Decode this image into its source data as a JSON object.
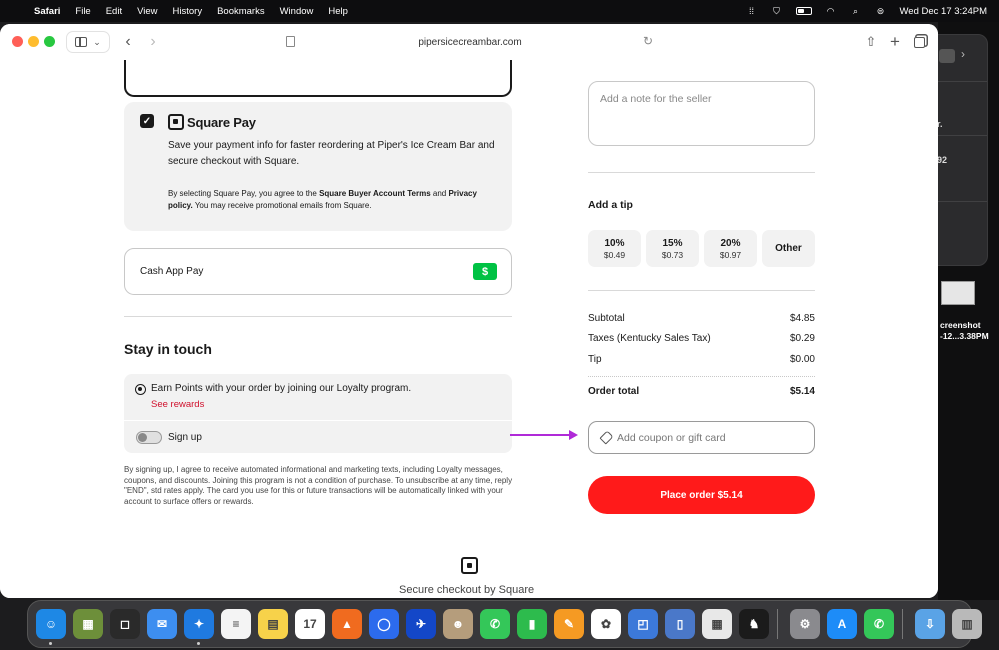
{
  "menubar": {
    "app_name": "Safari",
    "menus": [
      "File",
      "Edit",
      "View",
      "History",
      "Bookmarks",
      "Window",
      "Help"
    ],
    "datetime": "Wed Dec 17  3:24PM"
  },
  "browser": {
    "url": "pipersicecreambar.com"
  },
  "square_pay": {
    "name": "Square Pay",
    "description": "Save your payment info for faster reordering at Piper's Ice Cream Bar and secure checkout with Square.",
    "legal_prefix": "By selecting Square Pay, you agree to the ",
    "legal_terms_link": "Square Buyer Account Terms",
    "legal_and": " and ",
    "legal_privacy_link": "Privacy policy.",
    "legal_suffix": " You may receive promotional emails from Square.",
    "checked": true
  },
  "cash_app": {
    "label": "Cash App Pay",
    "icon_glyph": "$"
  },
  "stay_in_touch": {
    "heading": "Stay in touch",
    "loyalty_text": "Earn Points with your order by joining our Loyalty program.",
    "see_rewards": "See rewards",
    "signup_label": "Sign up",
    "legal": "By signing up, I agree to receive automated informational and marketing texts, including Loyalty messages, coupons, and discounts. Joining this program is not a condition of purchase. To unsubscribe at any time, reply \"END\", std rates apply. The card you use for this or future transactions will be automatically linked with your account to surface offers or rewards."
  },
  "seller_note": {
    "placeholder": "Add a note for the seller"
  },
  "tip": {
    "heading": "Add a tip",
    "options": [
      {
        "pct": "10%",
        "amount": "$0.49"
      },
      {
        "pct": "15%",
        "amount": "$0.73"
      },
      {
        "pct": "20%",
        "amount": "$0.97"
      },
      {
        "pct": "Other",
        "amount": ""
      }
    ]
  },
  "summary": {
    "subtotal_label": "Subtotal",
    "subtotal_value": "$4.85",
    "taxes_label": "Taxes (Kentucky Sales Tax)",
    "taxes_value": "$0.29",
    "tip_label": "Tip",
    "tip_value": "$0.00",
    "total_label": "Order total",
    "total_value": "$5.14"
  },
  "coupon": {
    "placeholder": "Add coupon or gift card"
  },
  "place_order": {
    "label": "Place order  $5.14"
  },
  "footer": {
    "secure_text": "Secure checkout by Square"
  },
  "desktop": {
    "bg_window_texts": [
      "r.",
      "92"
    ],
    "screenshot_label_line1": "creenshot",
    "screenshot_label_line2": "-12...3.38PM"
  },
  "dock": {
    "apps": [
      {
        "name": "Finder",
        "color": "#1e88e5",
        "glyph": "☺"
      },
      {
        "name": "Archive",
        "color": "#6d8f3a",
        "glyph": "▦"
      },
      {
        "name": "Square",
        "color": "#2a2a2a",
        "glyph": "◻"
      },
      {
        "name": "Mail",
        "color": "#3d8ef0",
        "glyph": "✉"
      },
      {
        "name": "Safari",
        "color": "#1f7ae0",
        "glyph": "✦"
      },
      {
        "name": "Reminders",
        "color": "#f4f4f4",
        "glyph": "≡"
      },
      {
        "name": "Notes",
        "color": "#f7d24a",
        "glyph": "▤"
      },
      {
        "name": "Calendar",
        "color": "#ffffff",
        "glyph": "17"
      },
      {
        "name": "Brave",
        "color": "#f06b1f",
        "glyph": "▲"
      },
      {
        "name": "Signal",
        "color": "#2c6bed",
        "glyph": "◯"
      },
      {
        "name": "Astro",
        "color": "#1347c8",
        "glyph": "✈"
      },
      {
        "name": "Contacts",
        "color": "#b59d7c",
        "glyph": "☻"
      },
      {
        "name": "Messages",
        "color": "#34c759",
        "glyph": "✆"
      },
      {
        "name": "Numbers",
        "color": "#2dbb4d",
        "glyph": "▮"
      },
      {
        "name": "Pages",
        "color": "#f59a23",
        "glyph": "✎"
      },
      {
        "name": "Photos",
        "color": "#ffffff",
        "glyph": "✿"
      },
      {
        "name": "Preview",
        "color": "#3c79d9",
        "glyph": "◰"
      },
      {
        "name": "Simulator",
        "color": "#4a78c9",
        "glyph": "▯"
      },
      {
        "name": "Launchpad",
        "color": "#e8e8e8",
        "glyph": "▦"
      },
      {
        "name": "Kindle",
        "color": "#1b1b1b",
        "glyph": "♞"
      },
      {
        "name": "System Settings",
        "color": "#8a8a8e",
        "glyph": "⚙"
      },
      {
        "name": "App Store",
        "color": "#1d8cf8",
        "glyph": "A"
      },
      {
        "name": "Phone",
        "color": "#34c759",
        "glyph": "✆"
      },
      {
        "name": "Downloads",
        "color": "#5aa3e6",
        "glyph": "⇩"
      },
      {
        "name": "Trash",
        "color": "#b9b9b9",
        "glyph": "▥"
      }
    ]
  }
}
